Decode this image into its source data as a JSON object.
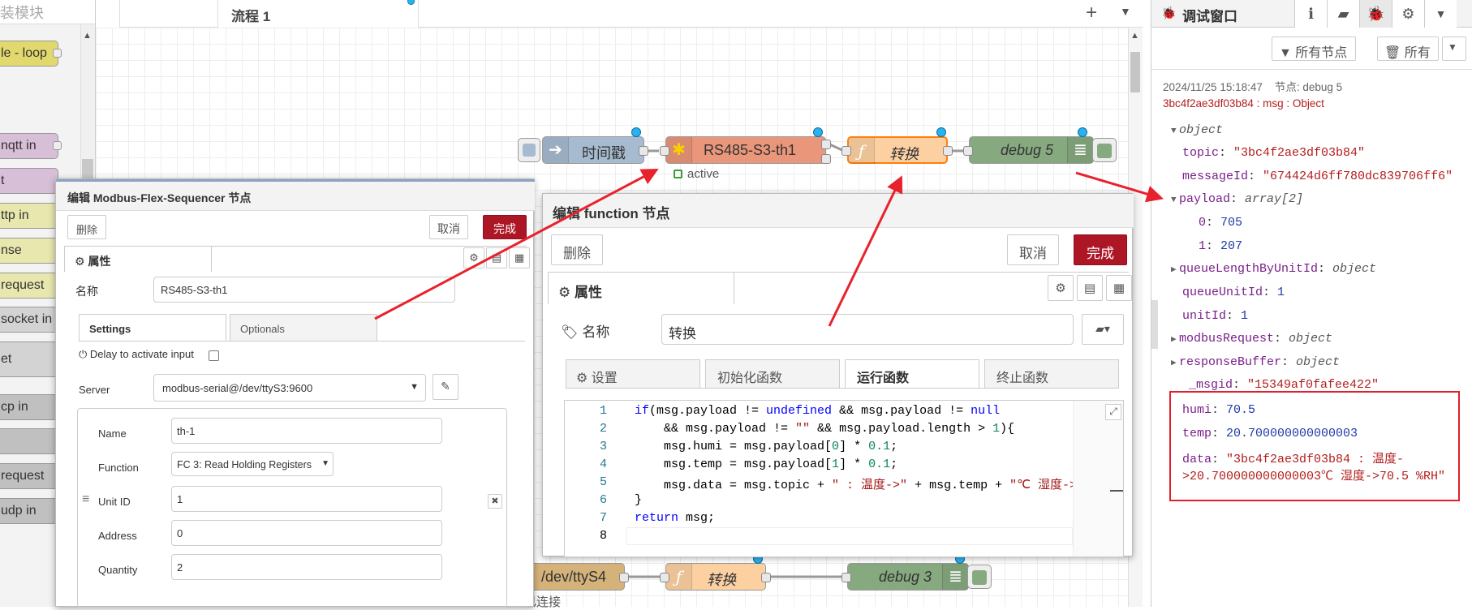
{
  "palette": {
    "search_text": "装模块",
    "nodes": [
      {
        "label": "le - loop",
        "color": "#e2d96e"
      },
      {
        "label": "nqtt in",
        "color": "#d8bfd8"
      },
      {
        "label": "t",
        "color": "#d8bfd8"
      },
      {
        "label": "ttp in",
        "color": "#e7e7ae"
      },
      {
        "label": "nse",
        "color": "#e7e7ae"
      },
      {
        "label": "request",
        "color": "#e7e7ae"
      },
      {
        "label": "socket in",
        "color": "#d3d3d3"
      },
      {
        "label": "et",
        "color": "#d3d3d3"
      },
      {
        "label": "cp in",
        "color": "#c0c0c0"
      },
      {
        "label": "",
        "color": "#c0c0c0"
      },
      {
        "label": "request",
        "color": "#c0c0c0"
      },
      {
        "label": "udp in",
        "color": "#c0c0c0"
      }
    ]
  },
  "workspace": {
    "tab_label": "流程 1",
    "add_icon": "plus-icon",
    "menu_icon": "chevron-down-icon",
    "nodes": {
      "inject": {
        "label": "时间戳",
        "color": "#a6bbcf"
      },
      "modbus": {
        "label": "RS485-S3-th1",
        "color": "#e9967a",
        "status": "active"
      },
      "func1": {
        "label": "转换",
        "color": "#fdd0a2"
      },
      "debug5": {
        "label": "debug 5",
        "color": "#87a980"
      },
      "serial4": {
        "label": "/dev/ttyS4",
        "color": "#d5b27a"
      },
      "func2": {
        "label": "转换",
        "color": "#fdd0a2"
      },
      "debug3": {
        "label": "debug 3",
        "color": "#87a980"
      },
      "connected": "已连接"
    }
  },
  "modbus_dialog": {
    "title": "编辑 Modbus-Flex-Sequencer 节点",
    "delete_label": "删除",
    "cancel_label": "取消",
    "done_label": "完成",
    "props_tab": "属性",
    "name_label": "名称",
    "name_value": "RS485-S3-th1",
    "tabs": [
      "Settings",
      "Optionals"
    ],
    "delay_label": "Delay to activate input",
    "server_label": "Server",
    "server_value": "modbus-serial@/dev/ttyS3:9600",
    "seq": {
      "name_label": "Name",
      "name_value": "th-1",
      "function_label": "Function",
      "function_value": "FC 3: Read Holding Registers",
      "unitid_label": "Unit ID",
      "unitid_value": "1",
      "address_label": "Address",
      "address_value": "0",
      "quantity_label": "Quantity",
      "quantity_value": "2"
    }
  },
  "function_dialog": {
    "title": "编辑 function 节点",
    "delete_label": "删除",
    "cancel_label": "取消",
    "done_label": "完成",
    "props_tab": "属性",
    "name_label": "名称",
    "name_value": "转换",
    "tabs": [
      "设置",
      "初始化函数",
      "运行函数",
      "终止函数"
    ],
    "line_numbers": [
      "1",
      "2",
      "3",
      "4",
      "5",
      "6",
      "7",
      "8"
    ]
  },
  "sidebar": {
    "title": "调试窗口",
    "filter_nodes_label": "所有节点",
    "clear_label": "所有",
    "message": {
      "timestamp": "2024/11/25 15:18:47",
      "node_label": "节点: debug 5",
      "topic_line": "3bc4f2ae3df03b84 : msg : Object",
      "root_type": "object",
      "topic": "\"3bc4f2ae3df03b84\"",
      "messageId": "\"674424d6ff780dc839706ff6\"",
      "payload_type": "array[2]",
      "payload_0": "705",
      "payload_1": "207",
      "queueLengthByUnitId": "object",
      "queueUnitId": "1",
      "unitId": "1",
      "modbusRequest": "object",
      "responseBuffer": "object",
      "msgid": "\"15349af0fafee422\"",
      "humi": "70.5",
      "temp": "20.700000000000003",
      "data_line1": "\"3bc4f2ae3df03b84 : 温度-",
      "data_line2": ">20.700000000000003℃ 湿度->70.5 %RH\""
    }
  },
  "colors": {
    "accent_red": "#e0202c",
    "arrow_red": "#e8222d",
    "primary": "#ad1625"
  }
}
